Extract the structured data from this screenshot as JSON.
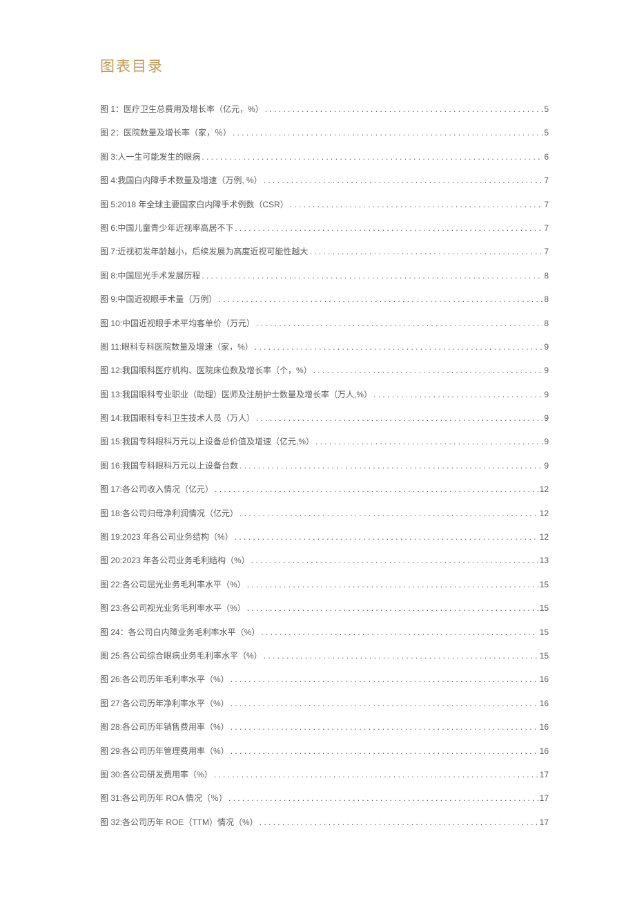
{
  "title": "图表目录",
  "toc": [
    {
      "text": "图 1：医疗卫生总费用及增长率（亿元，%）",
      "page": "5"
    },
    {
      "text": "图 2：医院数量及增长率（家，％）",
      "page": "5"
    },
    {
      "text": "图 3:人一生可能发生的眼病",
      "page": "6"
    },
    {
      "text": "图 4:我国白内障手术数量及增速（万例, %）",
      "page": "7"
    },
    {
      "text": "图 5:2018 年全球主要国家白内障手术例数（CSR）",
      "page": "7"
    },
    {
      "text": "图 6:中国儿童青少年近视率高居不下",
      "page": "7"
    },
    {
      "text": "图 7:近视初发年龄越小，后续发展为高度近视可能性越大",
      "page": "7"
    },
    {
      "text": "图 8:中国屈光手术发展历程",
      "page": "8"
    },
    {
      "text": "图 9:中国近视眼手术量（万例）",
      "page": "8"
    },
    {
      "text": "图 10:中国近视眼手术平均客单价（万元）",
      "page": "8"
    },
    {
      "text": "图 11:眼科专科医院数量及增速（家，%）",
      "page": "9"
    },
    {
      "text": "图 12:我国眼科医疗机构、医院床位数及增长率（个，%）",
      "page": "9"
    },
    {
      "text": "图 13:我国眼科专业职业（助理）医师及注册护士数量及增长率（万人,%）",
      "page": "9"
    },
    {
      "text": "图 14:我国眼科专科卫生技术人员（万人）",
      "page": "9"
    },
    {
      "text": "图 15:我国专科眼科万元以上设备总价值及增速（亿元,%）",
      "page": "9"
    },
    {
      "text": "图 16:我国专科眼科万元以上设备台数",
      "page": "9"
    },
    {
      "text": "图 17:各公司收入情况（亿元）",
      "page": "12"
    },
    {
      "text": "图 18:各公司归母净利润情况（亿元）",
      "page": "12"
    },
    {
      "text": "图 19:2023 年各公司业务结构（%）",
      "page": "12"
    },
    {
      "text": "图 20:2023 年各公司业务毛利结构（%）",
      "page": "13"
    },
    {
      "text": "图 22:各公司屈光业务毛利率水平（%）",
      "page": "15"
    },
    {
      "text": "图 23:各公司视光业务毛利率水平（%）",
      "page": "15"
    },
    {
      "text": "图 24：各公司白内障业务毛利率水平（%）",
      "page": "15"
    },
    {
      "text": "图 25:各公司综合眼病业务毛利率水平（%）",
      "page": "15"
    },
    {
      "text": "图 26:各公司历年毛利率水平（%）",
      "page": "16"
    },
    {
      "text": "图 27:各公司历年净利率水平（%）",
      "page": "16"
    },
    {
      "text": "图 28:各公司历年销售费用率（%）",
      "page": "16"
    },
    {
      "text": "图 29:各公司历年管理费用率（%）",
      "page": "16"
    },
    {
      "text": "图 30:各公司研发费用率（%）",
      "page": "17"
    },
    {
      "text": "图 31:各公司历年 ROA 情况（％）",
      "page": "17"
    },
    {
      "text": "图 32:各公司历年 ROE（TTM）情况（%）",
      "page": "17"
    }
  ]
}
